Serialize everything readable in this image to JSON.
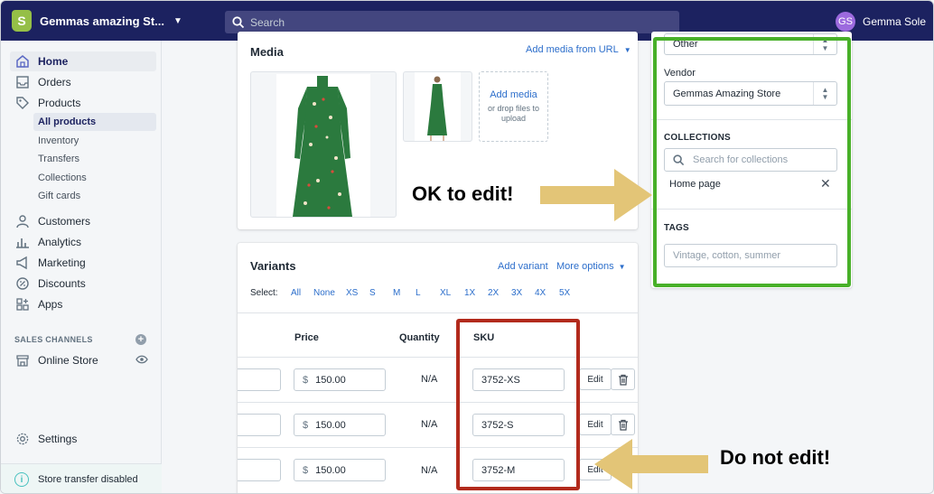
{
  "topbar": {
    "store_name": "Gemmas amazing St...",
    "search_placeholder": "Search",
    "avatar_initials": "GS",
    "user_name": "Gemma Sole"
  },
  "sidebar": {
    "items": [
      {
        "label": "Home"
      },
      {
        "label": "Orders"
      },
      {
        "label": "Products"
      }
    ],
    "product_subitems": [
      "All products",
      "Inventory",
      "Transfers",
      "Collections",
      "Gift cards"
    ],
    "more_items": [
      {
        "label": "Customers"
      },
      {
        "label": "Analytics"
      },
      {
        "label": "Marketing"
      },
      {
        "label": "Discounts"
      },
      {
        "label": "Apps"
      }
    ],
    "sales_channels_label": "SALES CHANNELS",
    "online_store": "Online Store",
    "settings": "Settings",
    "store_transfer": "Store transfer disabled"
  },
  "media": {
    "title": "Media",
    "add_from_url": "Add media from URL",
    "add_media": "Add media",
    "drop_hint": "or drop files to upload"
  },
  "variants": {
    "title": "Variants",
    "add_variant": "Add variant",
    "more_options": "More options",
    "select_label": "Select:",
    "select_options": [
      "All",
      "None",
      "XS",
      "S",
      "M",
      "L",
      "XL",
      "1X",
      "2X",
      "3X",
      "4X",
      "5X"
    ],
    "headers": {
      "price": "Price",
      "quantity": "Quantity",
      "sku": "SKU"
    },
    "rows": [
      {
        "currency": "$",
        "price": "150.00",
        "quantity": "N/A",
        "sku": "3752-XS",
        "edit": "Edit"
      },
      {
        "currency": "$",
        "price": "150.00",
        "quantity": "N/A",
        "sku": "3752-S",
        "edit": "Edit"
      },
      {
        "currency": "$",
        "price": "150.00",
        "quantity": "N/A",
        "sku": "3752-M",
        "edit": "Edit"
      }
    ]
  },
  "organization": {
    "type_value": "Other",
    "vendor_label": "Vendor",
    "vendor_value": "Gemmas Amazing Store",
    "collections_label": "COLLECTIONS",
    "collections_placeholder": "Search for collections",
    "collection_item": "Home page",
    "tags_label": "TAGS",
    "tags_placeholder": "Vintage, cotton, summer"
  },
  "annotations": {
    "ok_text": "OK to edit!",
    "no_text": "Do not edit!",
    "ok_color": "#48b029",
    "no_color": "#b22a1c",
    "arrow_color": "#e3c577"
  },
  "colors": {
    "topbar": "#1c2260",
    "link": "#2c6ecb",
    "avatar": "#9c6ade"
  }
}
